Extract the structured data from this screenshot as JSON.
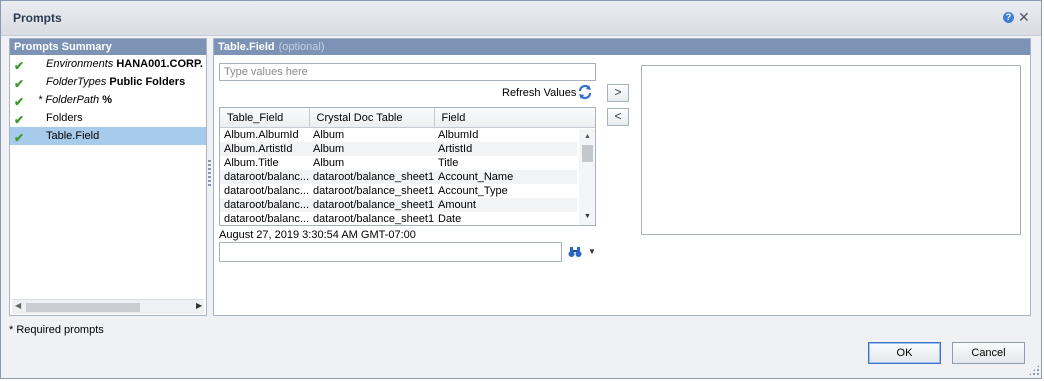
{
  "window": {
    "title": "Prompts"
  },
  "summary": {
    "header": "Prompts Summary",
    "items": [
      {
        "key": "Environments",
        "value": "HANA001.CORP.",
        "checked": true,
        "required": false
      },
      {
        "key": "FolderTypes",
        "value": "Public Folders",
        "checked": true,
        "required": false
      },
      {
        "key": "FolderPath",
        "value": "%",
        "checked": true,
        "required": true,
        "required_mark": "* "
      },
      {
        "label": "Folders",
        "checked": true
      },
      {
        "label": "Table.Field",
        "checked": true,
        "selected": true
      }
    ]
  },
  "detail": {
    "header": "Table.Field",
    "header_optional": "(optional)",
    "value_placeholder": "Type values here",
    "refresh_label": "Refresh Values",
    "columns": [
      "Table_Field",
      "Crystal Doc Table",
      "Field"
    ],
    "rows": [
      [
        "Album.AlbumId",
        "Album",
        "AlbumId"
      ],
      [
        "Album.ArtistId",
        "Album",
        "ArtistId"
      ],
      [
        "Album.Title",
        "Album",
        "Title"
      ],
      [
        "dataroot/balanc...",
        "dataroot/balance_sheet1",
        "Account_Name"
      ],
      [
        "dataroot/balanc...",
        "dataroot/balance_sheet1",
        "Account_Type"
      ],
      [
        "dataroot/balanc...",
        "dataroot/balance_sheet1",
        "Amount"
      ],
      [
        "dataroot/balanc...",
        "dataroot/balance_sheet1",
        "Date"
      ]
    ],
    "timestamp": "August 27, 2019 3:30:54 AM GMT-07:00",
    "search_value": "",
    "add_label": ">",
    "remove_label": "<"
  },
  "footer": {
    "required_note": "* Required prompts",
    "ok_label": "OK",
    "cancel_label": "Cancel"
  },
  "colors": {
    "header_bg": "#7c93b5",
    "selected_bg": "#a7cbea",
    "check": "#3f9a2f"
  },
  "icons": [
    "help-icon",
    "close-icon",
    "check-icon",
    "refresh-icon",
    "binoculars-icon",
    "chevron-down-icon"
  ]
}
